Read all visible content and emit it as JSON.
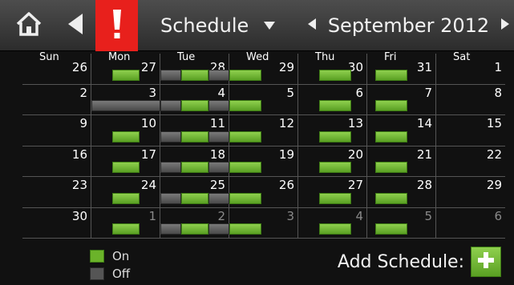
{
  "header": {
    "home_icon": "home-icon",
    "back_icon": "back-arrow-icon",
    "alert_icon": "alert-exclamation-icon",
    "title": "Schedule",
    "title_dropdown_icon": "triangle-down-icon",
    "month": "September 2012",
    "prev_icon": "triangle-left-icon",
    "next_icon": "triangle-right-icon",
    "alert_color": "#e8201c"
  },
  "calendar": {
    "day_headers": [
      "Sun",
      "Mon",
      "Tue",
      "Wed",
      "Thu",
      "Fri",
      "Sat"
    ],
    "weeks": [
      {
        "days": [
          {
            "n": "26",
            "dim": false,
            "bars": []
          },
          {
            "n": "27",
            "dim": false,
            "bars": [
              [
                "on",
                0.3,
                0.7
              ]
            ]
          },
          {
            "n": "28",
            "dim": false,
            "bars": [
              [
                "off",
                0.0,
                0.3
              ],
              [
                "on",
                0.3,
                0.7
              ],
              [
                "off",
                0.7,
                1.0
              ]
            ]
          },
          {
            "n": "29",
            "dim": false,
            "bars": [
              [
                "on",
                0.0,
                0.47
              ]
            ]
          },
          {
            "n": "30",
            "dim": false,
            "bars": [
              [
                "on",
                0.3,
                0.77
              ]
            ]
          },
          {
            "n": "31",
            "dim": false,
            "bars": [
              [
                "on",
                0.12,
                0.58
              ]
            ]
          },
          {
            "n": "1",
            "dim": false,
            "bars": []
          }
        ]
      },
      {
        "days": [
          {
            "n": "2",
            "dim": false,
            "bars": []
          },
          {
            "n": "3",
            "dim": false,
            "bars": [
              [
                "off",
                0.0,
                1.0
              ]
            ]
          },
          {
            "n": "4",
            "dim": false,
            "bars": [
              [
                "off",
                0.0,
                0.3
              ],
              [
                "on",
                0.3,
                0.7
              ],
              [
                "off",
                0.7,
                1.0
              ]
            ]
          },
          {
            "n": "5",
            "dim": false,
            "bars": [
              [
                "on",
                0.0,
                0.47
              ]
            ]
          },
          {
            "n": "6",
            "dim": false,
            "bars": [
              [
                "on",
                0.3,
                0.77
              ]
            ]
          },
          {
            "n": "7",
            "dim": false,
            "bars": [
              [
                "on",
                0.12,
                0.58
              ]
            ]
          },
          {
            "n": "8",
            "dim": false,
            "bars": []
          }
        ]
      },
      {
        "days": [
          {
            "n": "9",
            "dim": false,
            "bars": []
          },
          {
            "n": "10",
            "dim": false,
            "bars": [
              [
                "on",
                0.3,
                0.7
              ]
            ]
          },
          {
            "n": "11",
            "dim": false,
            "bars": [
              [
                "off",
                0.0,
                0.3
              ],
              [
                "on",
                0.3,
                0.7
              ],
              [
                "off",
                0.7,
                1.0
              ]
            ]
          },
          {
            "n": "12",
            "dim": false,
            "bars": [
              [
                "on",
                0.0,
                0.47
              ]
            ]
          },
          {
            "n": "13",
            "dim": false,
            "bars": [
              [
                "on",
                0.3,
                0.77
              ]
            ]
          },
          {
            "n": "14",
            "dim": false,
            "bars": [
              [
                "on",
                0.12,
                0.58
              ]
            ]
          },
          {
            "n": "15",
            "dim": false,
            "bars": []
          }
        ]
      },
      {
        "days": [
          {
            "n": "16",
            "dim": false,
            "bars": []
          },
          {
            "n": "17",
            "dim": false,
            "bars": [
              [
                "on",
                0.3,
                0.7
              ]
            ]
          },
          {
            "n": "18",
            "dim": false,
            "bars": [
              [
                "off",
                0.0,
                0.3
              ],
              [
                "on",
                0.3,
                0.7
              ],
              [
                "off",
                0.7,
                1.0
              ]
            ]
          },
          {
            "n": "19",
            "dim": false,
            "bars": [
              [
                "on",
                0.0,
                0.47
              ]
            ]
          },
          {
            "n": "20",
            "dim": false,
            "bars": [
              [
                "on",
                0.3,
                0.77
              ]
            ]
          },
          {
            "n": "21",
            "dim": false,
            "bars": [
              [
                "on",
                0.12,
                0.58
              ]
            ]
          },
          {
            "n": "22",
            "dim": false,
            "bars": []
          }
        ]
      },
      {
        "days": [
          {
            "n": "23",
            "dim": false,
            "bars": []
          },
          {
            "n": "24",
            "dim": false,
            "bars": [
              [
                "on",
                0.3,
                0.7
              ]
            ]
          },
          {
            "n": "25",
            "dim": false,
            "bars": [
              [
                "off",
                0.0,
                0.3
              ],
              [
                "on",
                0.3,
                0.7
              ],
              [
                "off",
                0.7,
                1.0
              ]
            ]
          },
          {
            "n": "26",
            "dim": false,
            "bars": [
              [
                "on",
                0.0,
                0.47
              ]
            ]
          },
          {
            "n": "27",
            "dim": false,
            "bars": [
              [
                "on",
                0.3,
                0.77
              ]
            ]
          },
          {
            "n": "28",
            "dim": false,
            "bars": [
              [
                "on",
                0.12,
                0.58
              ]
            ]
          },
          {
            "n": "29",
            "dim": false,
            "bars": []
          }
        ]
      },
      {
        "days": [
          {
            "n": "30",
            "dim": false,
            "bars": []
          },
          {
            "n": "1",
            "dim": true,
            "bars": [
              [
                "on",
                0.3,
                0.7
              ]
            ]
          },
          {
            "n": "2",
            "dim": true,
            "bars": [
              [
                "off",
                0.0,
                0.3
              ],
              [
                "on",
                0.3,
                0.7
              ],
              [
                "off",
                0.7,
                1.0
              ]
            ]
          },
          {
            "n": "3",
            "dim": true,
            "bars": [
              [
                "on",
                0.0,
                0.47
              ]
            ]
          },
          {
            "n": "4",
            "dim": true,
            "bars": [
              [
                "on",
                0.3,
                0.77
              ]
            ]
          },
          {
            "n": "5",
            "dim": true,
            "bars": [
              [
                "on",
                0.12,
                0.58
              ]
            ]
          },
          {
            "n": "6",
            "dim": true,
            "bars": []
          }
        ]
      }
    ]
  },
  "legend": {
    "on_label": "On",
    "off_label": "Off",
    "on_color": "#6bb32a",
    "off_color": "#555555"
  },
  "add": {
    "label": "Add Schedule:",
    "icon": "plus-icon"
  }
}
